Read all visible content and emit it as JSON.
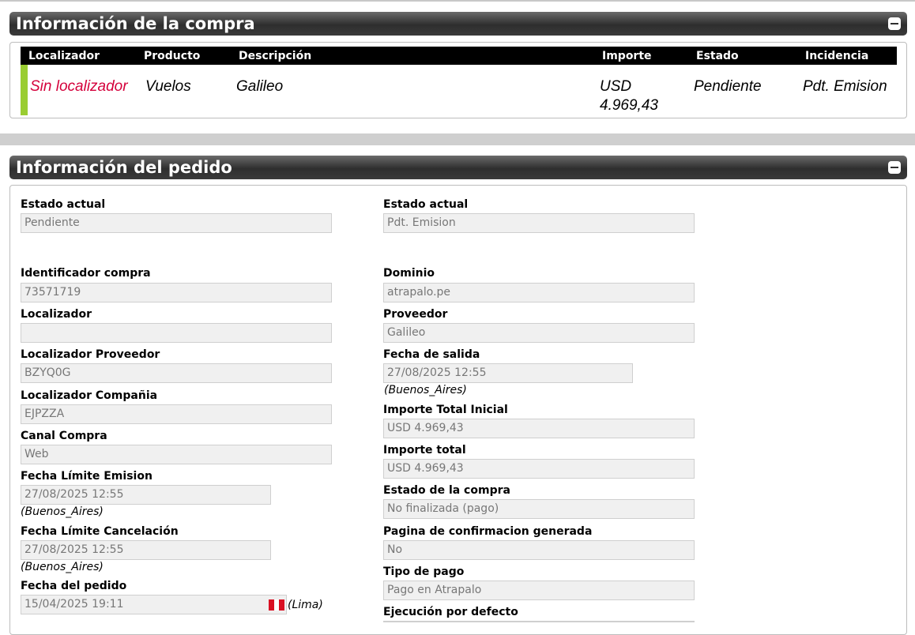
{
  "purchase_panel": {
    "title": "Información de la compra",
    "columns": [
      "Localizador",
      "Producto",
      "Descripción",
      "Importe",
      "Estado",
      "Incidencia"
    ],
    "row": {
      "localizador": "Sin localizador",
      "producto": "Vuelos",
      "descripcion": "Galileo",
      "importe_line1": "USD",
      "importe_line2": "4.969,43",
      "estado": "Pendiente",
      "incidencia": "Pdt. Emision"
    },
    "colors": {
      "localizador_text": "#d4003b",
      "status_bar": "#9acd32"
    }
  },
  "order_panel": {
    "title": "Información del pedido",
    "left": {
      "estado_actual": {
        "label": "Estado actual",
        "value": "Pendiente"
      },
      "identificador_compra": {
        "label": "Identificador compra",
        "value": "73571719"
      },
      "localizador": {
        "label": "Localizador",
        "value": ""
      },
      "localizador_proveedor": {
        "label": "Localizador Proveedor",
        "value": "BZYQ0G"
      },
      "localizador_compania": {
        "label": "Localizador Compañia",
        "value": "EJPZZA"
      },
      "canal_compra": {
        "label": "Canal Compra",
        "value": "Web"
      },
      "fecha_limite_emision": {
        "label": "Fecha Límite Emision",
        "value": "27/08/2025 12:55",
        "tz": "(Buenos_Aires)"
      },
      "fecha_limite_cancelacion": {
        "label": "Fecha Límite Cancelación",
        "value": "27/08/2025 12:55",
        "tz": "(Buenos_Aires)"
      },
      "fecha_pedido": {
        "label": "Fecha del pedido",
        "value": "15/04/2025 19:11",
        "tz": "(Lima)",
        "flag_icon": "peru-flag-icon"
      }
    },
    "right": {
      "estado_actual": {
        "label": "Estado actual",
        "value": "Pdt. Emision"
      },
      "dominio": {
        "label": "Dominio",
        "value": "atrapalo.pe"
      },
      "proveedor": {
        "label": "Proveedor",
        "value": "Galileo"
      },
      "fecha_salida": {
        "label": "Fecha de salida",
        "value": "27/08/2025 12:55",
        "tz": "(Buenos_Aires)"
      },
      "importe_total_inicial": {
        "label": "Importe Total Inicial",
        "value": "USD 4.969,43"
      },
      "importe_total": {
        "label": "Importe total",
        "value": "USD 4.969,43"
      },
      "estado_compra": {
        "label": "Estado de la compra",
        "value": "No finalizada (pago)"
      },
      "pagina_confirmacion": {
        "label": "Pagina de confirmacion generada",
        "value": "No"
      },
      "tipo_pago": {
        "label": "Tipo de pago",
        "value": "Pago en Atrapalo"
      },
      "ejecucion_defecto": {
        "label": "Ejecución por defecto",
        "value": ""
      }
    }
  },
  "icons": {
    "collapse": "collapse-minus-icon"
  }
}
